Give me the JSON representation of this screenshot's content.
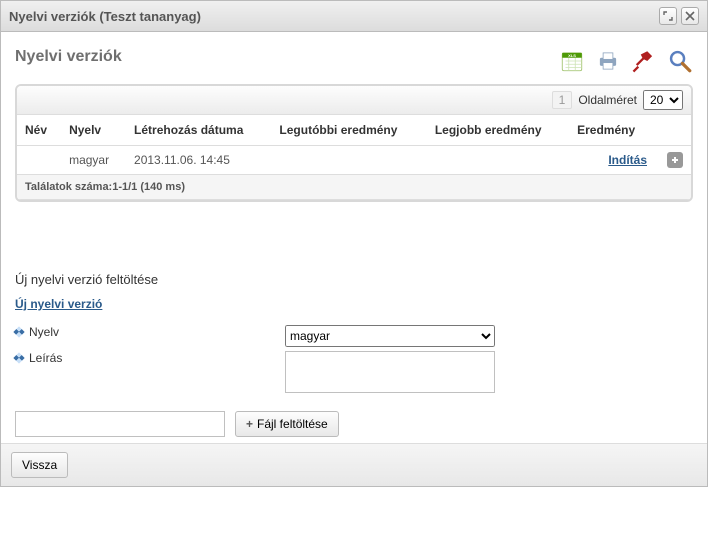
{
  "window": {
    "title": "Nyelvi verziók (Teszt tananyag)"
  },
  "header": {
    "title": "Nyelvi verziók"
  },
  "pager": {
    "page": "1",
    "sizeLabel": "Oldalméret",
    "sizeValue": "20"
  },
  "table": {
    "headers": {
      "name": "Név",
      "lang": "Nyelv",
      "created": "Létrehozás dátuma",
      "last": "Legutóbbi eredmény",
      "best": "Legjobb eredmény",
      "result": "Eredmény"
    },
    "rows": [
      {
        "name": "",
        "lang": "magyar",
        "created": "2013.11.06. 14:45",
        "last": "",
        "best": "",
        "action": "Indítás"
      }
    ],
    "summary": "Találatok száma:1-1/1 (140 ms)"
  },
  "upload": {
    "sectionTitle": "Új nyelvi verzió feltöltése",
    "link": "Új nyelvi verzió",
    "langLabel": "Nyelv",
    "langValue": "magyar",
    "descLabel": "Leírás",
    "descValue": "",
    "filePath": "",
    "uploadBtn": "Fájl feltöltése"
  },
  "footer": {
    "back": "Vissza"
  }
}
